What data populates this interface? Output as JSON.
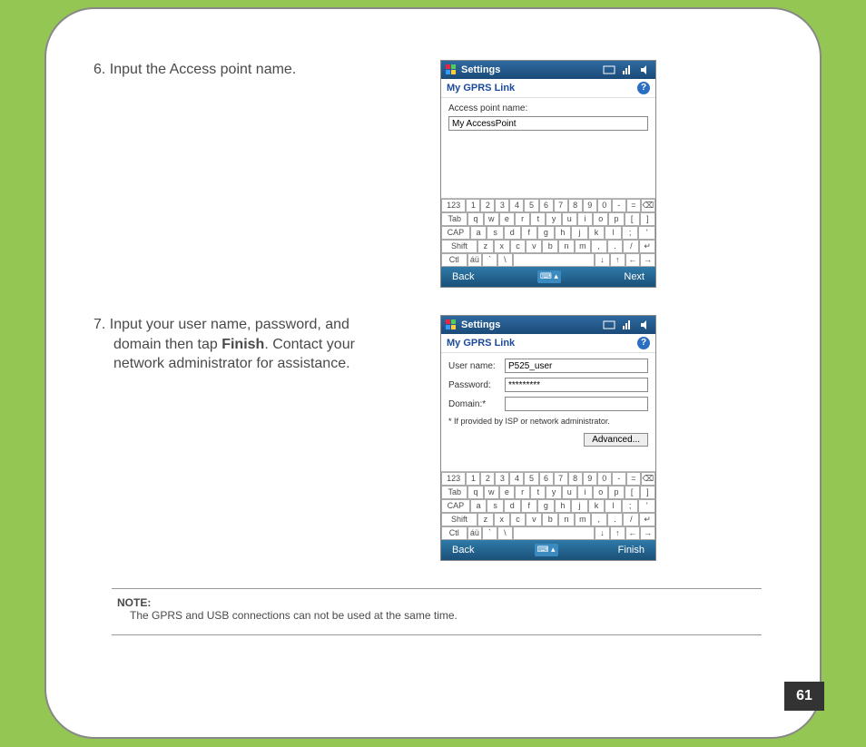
{
  "step6": {
    "number": "6.",
    "text_line1": "Input the Access point name.",
    "settings_title": "Settings",
    "settings_subtitle": "My GPRS Link",
    "field_label": "Access point name:",
    "field_value": "My AccessPoint",
    "btn_back": "Back",
    "btn_next": "Next"
  },
  "step7": {
    "number": "7.",
    "text_line1": "Input your user name, password, and",
    "text_line2_a": "domain then tap ",
    "text_line2_b": "Finish",
    "text_line2_c": ". Contact your",
    "text_line3": "network administrator for assistance.",
    "settings_title": "Settings",
    "settings_subtitle": "My GPRS Link",
    "user_label": "User name:",
    "user_value": "P525_user",
    "pass_label": "Password:",
    "pass_value": "*********",
    "domain_label": "Domain:*",
    "domain_value": "",
    "footnote": "* If provided by ISP or network administrator.",
    "advanced_btn": "Advanced...",
    "btn_back": "Back",
    "btn_finish": "Finish"
  },
  "keyboard": {
    "r1": [
      "123",
      "1",
      "2",
      "3",
      "4",
      "5",
      "6",
      "7",
      "8",
      "9",
      "0",
      "-",
      "=",
      "⌫"
    ],
    "r2": [
      "Tab",
      "q",
      "w",
      "e",
      "r",
      "t",
      "y",
      "u",
      "i",
      "o",
      "p",
      "[",
      "]"
    ],
    "r3": [
      "CAP",
      "a",
      "s",
      "d",
      "f",
      "g",
      "h",
      "j",
      "k",
      "l",
      ";",
      "'"
    ],
    "r4": [
      "Shift",
      "z",
      "x",
      "c",
      "v",
      "b",
      "n",
      "m",
      ",",
      ".",
      "/",
      "↵"
    ],
    "r5": [
      "Ctl",
      "áü",
      "`",
      "\\",
      " ",
      "↓",
      "↑",
      "←",
      "→"
    ]
  },
  "note": {
    "title": "NOTE:",
    "text": "The GPRS and USB connections can not be used at the same time."
  },
  "page_number": "61"
}
